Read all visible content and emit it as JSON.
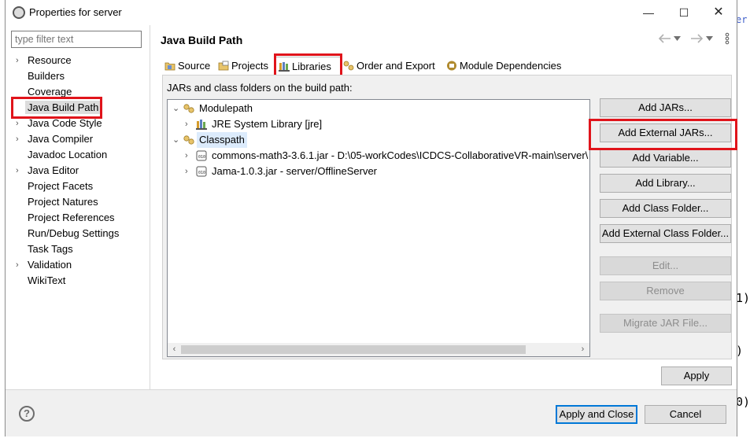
{
  "window": {
    "title": "Properties for server",
    "controls": {
      "minimize": "—",
      "maximize": "☐",
      "close": "✕"
    }
  },
  "filter": {
    "placeholder": "type filter text",
    "value": ""
  },
  "nav_tree": [
    {
      "label": "Resource",
      "expandable": true
    },
    {
      "label": "Builders",
      "expandable": false
    },
    {
      "label": "Coverage",
      "expandable": false
    },
    {
      "label": "Java Build Path",
      "expandable": false,
      "selected": true
    },
    {
      "label": "Java Code Style",
      "expandable": true
    },
    {
      "label": "Java Compiler",
      "expandable": true
    },
    {
      "label": "Javadoc Location",
      "expandable": false
    },
    {
      "label": "Java Editor",
      "expandable": true
    },
    {
      "label": "Project Facets",
      "expandable": false
    },
    {
      "label": "Project Natures",
      "expandable": false
    },
    {
      "label": "Project References",
      "expandable": false
    },
    {
      "label": "Run/Debug Settings",
      "expandable": false
    },
    {
      "label": "Task Tags",
      "expandable": false
    },
    {
      "label": "Validation",
      "expandable": true
    },
    {
      "label": "WikiText",
      "expandable": false
    }
  ],
  "page": {
    "title": "Java Build Path",
    "nav_icons": [
      "back-arrow-icon",
      "dropdown-icon",
      "forward-arrow-icon",
      "dropdown-icon",
      "menu-icon"
    ],
    "tabs": [
      {
        "label": "Source",
        "icon": "source-folder-icon"
      },
      {
        "label": "Projects",
        "icon": "projects-icon"
      },
      {
        "label": "Libraries",
        "icon": "libraries-icon",
        "active": true
      },
      {
        "label": "Order and Export",
        "icon": "order-export-icon"
      },
      {
        "label": "Module Dependencies",
        "icon": "module-icon"
      }
    ],
    "jars_label": "JARs and class folders on the build path:",
    "build_path": [
      {
        "label": "Modulepath",
        "expanded": true,
        "level": 0,
        "icon": "path-icon"
      },
      {
        "label": "JRE System Library [jre]",
        "expanded": false,
        "level": 1,
        "icon": "library-icon"
      },
      {
        "label": "Classpath",
        "expanded": true,
        "level": 0,
        "icon": "path-icon",
        "selected": true
      },
      {
        "label": "commons-math3-3.6.1.jar - D:\\05-workCodes\\ICDCS-CollaborativeVR-main\\server\\",
        "expanded": false,
        "level": 1,
        "icon": "jar-icon"
      },
      {
        "label": "Jama-1.0.3.jar - server/OfflineServer",
        "expanded": false,
        "level": 1,
        "icon": "jar-icon"
      }
    ],
    "buttons": [
      {
        "label": "Add JARs...",
        "enabled": true
      },
      {
        "label": "Add External JARs...",
        "enabled": true,
        "highlighted": true
      },
      {
        "label": "Add Variable...",
        "enabled": true
      },
      {
        "label": "Add Library...",
        "enabled": true
      },
      {
        "label": "Add Class Folder...",
        "enabled": true
      },
      {
        "label": "Add External Class Folder...",
        "enabled": true
      },
      {
        "label": "Edit...",
        "enabled": false
      },
      {
        "label": "Remove",
        "enabled": false
      },
      {
        "label": "Migrate JAR File...",
        "enabled": false
      }
    ],
    "apply": "Apply"
  },
  "footer": {
    "help_symbol": "?",
    "apply_close": "Apply and Close",
    "cancel": "Cancel"
  },
  "background_code": [
    "er",
    "1)",
    ")",
    "0)"
  ],
  "colors": {
    "highlight_box": "#e0141b",
    "selection": "#dcebfc",
    "default_button_border": "#0078d7"
  }
}
